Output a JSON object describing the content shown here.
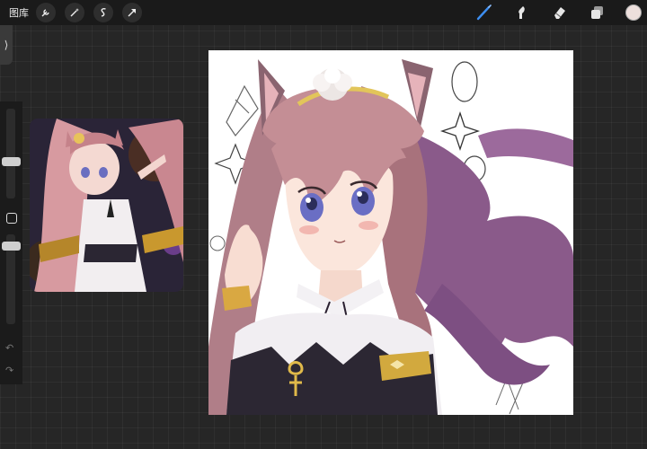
{
  "toolbar": {
    "gallery_label": "图库",
    "left_icons": [
      "wrench-icon",
      "magic-wand-icon",
      "selection-icon",
      "transform-arrow-icon"
    ],
    "right_icons": [
      "brush-icon",
      "smudge-icon",
      "eraser-icon",
      "layers-icon"
    ],
    "color": "#eddfdc"
  },
  "sidebar": {
    "collapse_glyph": "⟩",
    "undo_glyph": "↶",
    "redo_glyph": "↷"
  }
}
